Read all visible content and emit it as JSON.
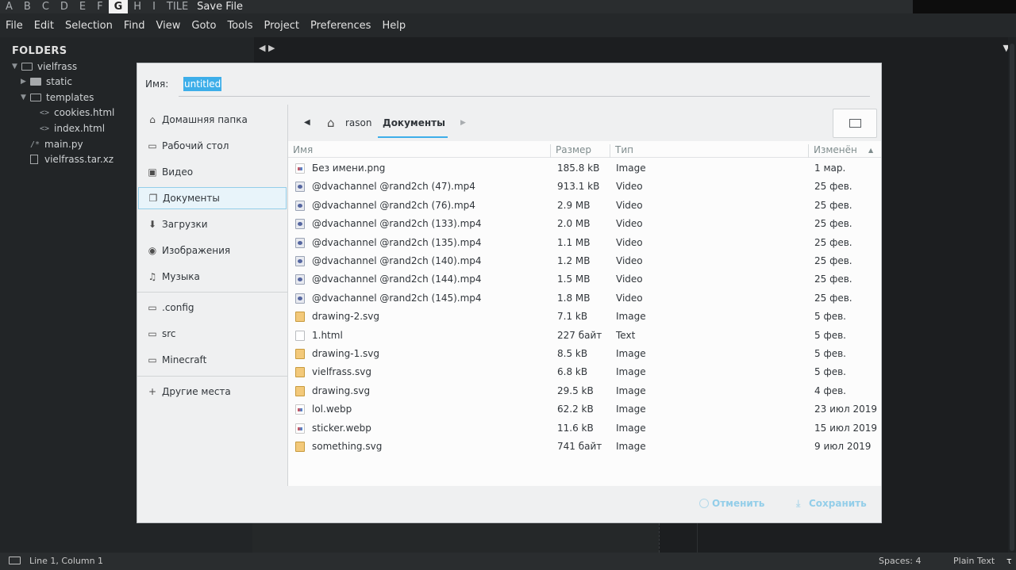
{
  "topbar": {
    "workspaces": [
      "A",
      "B",
      "C",
      "D",
      "E",
      "F",
      "G",
      "H",
      "I",
      "TILE"
    ],
    "active_workspace": "G",
    "title": "Save File"
  },
  "menubar": [
    "File",
    "Edit",
    "Selection",
    "Find",
    "View",
    "Goto",
    "Tools",
    "Project",
    "Preferences",
    "Help"
  ],
  "sidebar": {
    "header": "FOLDERS",
    "items": [
      {
        "label": "vielfrass",
        "kind": "folder-open",
        "expanded": true
      },
      {
        "label": "static",
        "kind": "folder",
        "expanded": false
      },
      {
        "label": "templates",
        "kind": "folder-open",
        "expanded": true
      },
      {
        "label": "cookies.html",
        "kind": "html"
      },
      {
        "label": "index.html",
        "kind": "html"
      },
      {
        "label": "main.py",
        "kind": "py"
      },
      {
        "label": "vielfrass.tar.xz",
        "kind": "file"
      }
    ]
  },
  "dialog": {
    "name_label": "Имя:",
    "name_value": "untitled",
    "places": [
      {
        "label": "Домашняя папка",
        "icon": "home-icon"
      },
      {
        "label": "Рабочий стол",
        "icon": "desktop-icon"
      },
      {
        "label": "Видео",
        "icon": "video-icon"
      },
      {
        "label": "Документы",
        "icon": "documents-icon",
        "selected": true
      },
      {
        "label": "Загрузки",
        "icon": "downloads-icon"
      },
      {
        "label": "Изображения",
        "icon": "camera-icon"
      },
      {
        "label": "Музыка",
        "icon": "music-icon"
      }
    ],
    "bookmarks": [
      {
        "label": ".config",
        "icon": "folder-icon"
      },
      {
        "label": "src",
        "icon": "folder-icon"
      },
      {
        "label": "Minecraft",
        "icon": "folder-icon"
      }
    ],
    "other_places": "Другие места",
    "path": {
      "home": "rason",
      "current": "Документы"
    },
    "columns": {
      "name": "Имя",
      "size": "Размер",
      "type": "Тип",
      "modified": "Изменён"
    },
    "files": [
      {
        "name": "Без имени.png",
        "size": "185.8 kB",
        "type": "Image",
        "modified": "1 мар.",
        "icon": "img"
      },
      {
        "name": "@dvachannel @rand2ch (47).mp4",
        "size": "913.1 kB",
        "type": "Video",
        "modified": "25 фев.",
        "icon": "vid"
      },
      {
        "name": "@dvachannel @rand2ch (76).mp4",
        "size": "2.9 MB",
        "type": "Video",
        "modified": "25 фев.",
        "icon": "vid"
      },
      {
        "name": "@dvachannel @rand2ch (133).mp4",
        "size": "2.0 MB",
        "type": "Video",
        "modified": "25 фев.",
        "icon": "vid"
      },
      {
        "name": "@dvachannel @rand2ch (135).mp4",
        "size": "1.1 MB",
        "type": "Video",
        "modified": "25 фев.",
        "icon": "vid"
      },
      {
        "name": "@dvachannel @rand2ch (140).mp4",
        "size": "1.2 MB",
        "type": "Video",
        "modified": "25 фев.",
        "icon": "vid"
      },
      {
        "name": "@dvachannel @rand2ch (144).mp4",
        "size": "1.5 MB",
        "type": "Video",
        "modified": "25 фев.",
        "icon": "vid"
      },
      {
        "name": "@dvachannel @rand2ch (145).mp4",
        "size": "1.8 MB",
        "type": "Video",
        "modified": "25 фев.",
        "icon": "vid"
      },
      {
        "name": "drawing-2.svg",
        "size": "7.1 kB",
        "type": "Image",
        "modified": "5 фев.",
        "icon": "svg"
      },
      {
        "name": "1.html",
        "size": "227 байт",
        "type": "Text",
        "modified": "5 фев.",
        "icon": "txt"
      },
      {
        "name": "drawing-1.svg",
        "size": "8.5 kB",
        "type": "Image",
        "modified": "5 фев.",
        "icon": "svg"
      },
      {
        "name": "vielfrass.svg",
        "size": "6.8 kB",
        "type": "Image",
        "modified": "5 фев.",
        "icon": "svg"
      },
      {
        "name": "drawing.svg",
        "size": "29.5 kB",
        "type": "Image",
        "modified": "4 фев.",
        "icon": "svg"
      },
      {
        "name": "lol.webp",
        "size": "62.2 kB",
        "type": "Image",
        "modified": "23 июл 2019",
        "icon": "img"
      },
      {
        "name": "sticker.webp",
        "size": "11.6 kB",
        "type": "Image",
        "modified": "15 июл 2019",
        "icon": "img"
      },
      {
        "name": "something.svg",
        "size": "741 байт",
        "type": "Image",
        "modified": "9 июл 2019",
        "icon": "svg"
      }
    ],
    "cancel_label": "Отменить",
    "save_label": "Сохранить"
  },
  "statusbar": {
    "position": "Line 1, Column 1",
    "spaces": "Spaces: 4",
    "syntax": "Plain Text",
    "corner": "τ"
  },
  "colors": {
    "accent": "#3daee9",
    "dialog_bg": "#eff0f1",
    "editor_bg": "#1c1e20"
  }
}
